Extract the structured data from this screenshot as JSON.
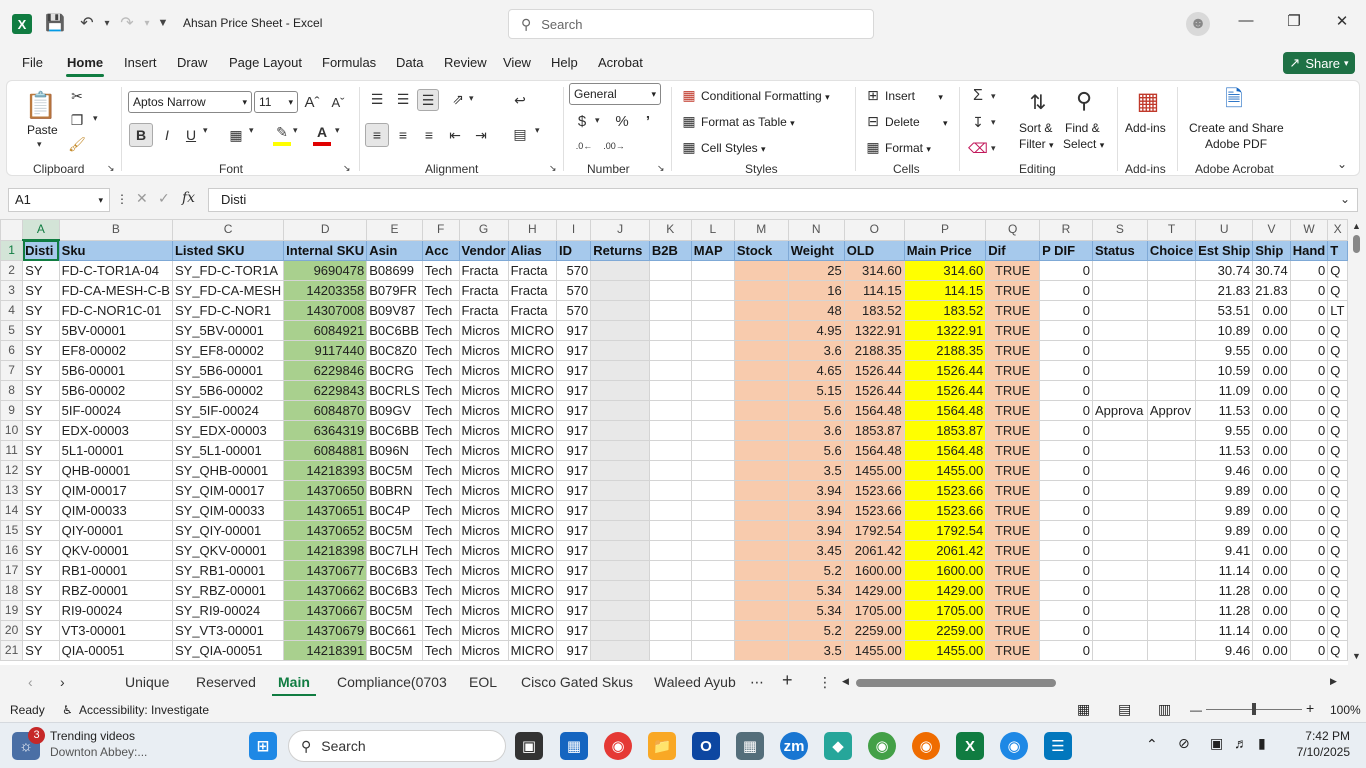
{
  "window": {
    "title": "Ahsan Price Sheet  -  Excel",
    "search_placeholder": "Search"
  },
  "menu": [
    "File",
    "Home",
    "Insert",
    "Draw",
    "Page Layout",
    "Formulas",
    "Data",
    "Review",
    "View",
    "Help",
    "Acrobat"
  ],
  "share_label": "Share",
  "ribbon": {
    "paste": "Paste",
    "clipboard": "Clipboard",
    "font_label": "Font",
    "alignment": "Alignment",
    "number": "Number",
    "styles": "Styles",
    "cells": "Cells",
    "editing": "Editing",
    "addins": "Add-ins",
    "adobe": "Adobe Acrobat",
    "font_name": "Aptos Narrow",
    "font_size": "11",
    "number_format": "General",
    "cond_format": "Conditional Formatting",
    "format_table": "Format as Table",
    "cell_styles": "Cell Styles",
    "insert": "Insert",
    "delete": "Delete",
    "format": "Format",
    "sort": "Sort &",
    "filter": "Filter",
    "find": "Find &",
    "select": "Select",
    "addins_btn": "Add-ins",
    "create_share": "Create and Share",
    "adobe_pdf": "Adobe PDF"
  },
  "formula_bar": {
    "name_box": "A1",
    "fx": "fx",
    "value": "Disti"
  },
  "columns": [
    "A",
    "B",
    "C",
    "D",
    "E",
    "F",
    "G",
    "H",
    "I",
    "J",
    "K",
    "L",
    "M",
    "N",
    "O",
    "P",
    "Q",
    "R",
    "S",
    "T",
    "U",
    "V",
    "W",
    "X"
  ],
  "header_row": [
    "Disti",
    "Sku",
    "Listed SKU",
    "Internal SKU",
    "Asin",
    "Acc",
    "Vendor",
    "Alias",
    "ID",
    "Returns",
    "B2B",
    "MAP",
    "Stock",
    "Weight",
    "OLD",
    "Main Price",
    "Dif",
    "P DIF",
    "Status",
    "Choice",
    "Est Ship",
    "Ship",
    "Hand",
    "T"
  ],
  "rows": [
    [
      "SY",
      "FD-C-TOR1A-04",
      "SY_FD-C-TOR1A",
      "9690478",
      "B08699",
      "Tech",
      "Fracta",
      "Fracta",
      "570",
      "",
      "",
      "",
      "",
      "25",
      "314.60",
      "314.60",
      "TRUE",
      "0",
      "",
      "",
      "30.74",
      "30.74",
      "0",
      "Q"
    ],
    [
      "SY",
      "FD-CA-MESH-C-B",
      "SY_FD-CA-MESH",
      "14203358",
      "B079FR",
      "Tech",
      "Fracta",
      "Fracta",
      "570",
      "",
      "",
      "",
      "",
      "16",
      "114.15",
      "114.15",
      "TRUE",
      "0",
      "",
      "",
      "21.83",
      "21.83",
      "0",
      "Q"
    ],
    [
      "SY",
      "FD-C-NOR1C-01",
      "SY_FD-C-NOR1",
      "14307008",
      "B09V87",
      "Tech",
      "Fracta",
      "Fracta",
      "570",
      "",
      "",
      "",
      "",
      "48",
      "183.52",
      "183.52",
      "TRUE",
      "0",
      "",
      "",
      "53.51",
      "0.00",
      "0",
      "LT"
    ],
    [
      "SY",
      "5BV-00001",
      "SY_5BV-00001",
      "6084921",
      "B0C6BB",
      "Tech",
      "Micros",
      "MICRO",
      "917",
      "",
      "",
      "",
      "",
      "4.95",
      "1322.91",
      "1322.91",
      "TRUE",
      "0",
      "",
      "",
      "10.89",
      "0.00",
      "0",
      "Q"
    ],
    [
      "SY",
      "EF8-00002",
      "SY_EF8-00002",
      "9117440",
      "B0C8Z0",
      "Tech",
      "Micros",
      "MICRO",
      "917",
      "",
      "",
      "",
      "",
      "3.6",
      "2188.35",
      "2188.35",
      "TRUE",
      "0",
      "",
      "",
      "9.55",
      "0.00",
      "0",
      "Q"
    ],
    [
      "SY",
      "5B6-00001",
      "SY_5B6-00001",
      "6229846",
      "B0CRG",
      "Tech",
      "Micros",
      "MICRO",
      "917",
      "",
      "",
      "",
      "",
      "4.65",
      "1526.44",
      "1526.44",
      "TRUE",
      "0",
      "",
      "",
      "10.59",
      "0.00",
      "0",
      "Q"
    ],
    [
      "SY",
      "5B6-00002",
      "SY_5B6-00002",
      "6229843",
      "B0CRLS",
      "Tech",
      "Micros",
      "MICRO",
      "917",
      "",
      "",
      "",
      "",
      "5.15",
      "1526.44",
      "1526.44",
      "TRUE",
      "0",
      "",
      "",
      "11.09",
      "0.00",
      "0",
      "Q"
    ],
    [
      "SY",
      "5IF-00024",
      "SY_5IF-00024",
      "6084870",
      "B09GV",
      "Tech",
      "Micros",
      "MICRO",
      "917",
      "",
      "",
      "",
      "",
      "5.6",
      "1564.48",
      "1564.48",
      "TRUE",
      "0",
      "Approva",
      "Approv",
      "11.53",
      "0.00",
      "0",
      "Q"
    ],
    [
      "SY",
      "EDX-00003",
      "SY_EDX-00003",
      "6364319",
      "B0C6BB",
      "Tech",
      "Micros",
      "MICRO",
      "917",
      "",
      "",
      "",
      "",
      "3.6",
      "1853.87",
      "1853.87",
      "TRUE",
      "0",
      "",
      "",
      "9.55",
      "0.00",
      "0",
      "Q"
    ],
    [
      "SY",
      "5L1-00001",
      "SY_5L1-00001",
      "6084881",
      "B096N",
      "Tech",
      "Micros",
      "MICRO",
      "917",
      "",
      "",
      "",
      "",
      "5.6",
      "1564.48",
      "1564.48",
      "TRUE",
      "0",
      "",
      "",
      "11.53",
      "0.00",
      "0",
      "Q"
    ],
    [
      "SY",
      "QHB-00001",
      "SY_QHB-00001",
      "14218393",
      "B0C5M",
      "Tech",
      "Micros",
      "MICRO",
      "917",
      "",
      "",
      "",
      "",
      "3.5",
      "1455.00",
      "1455.00",
      "TRUE",
      "0",
      "",
      "",
      "9.46",
      "0.00",
      "0",
      "Q"
    ],
    [
      "SY",
      "QIM-00017",
      "SY_QIM-00017",
      "14370650",
      "B0BRN",
      "Tech",
      "Micros",
      "MICRO",
      "917",
      "",
      "",
      "",
      "",
      "3.94",
      "1523.66",
      "1523.66",
      "TRUE",
      "0",
      "",
      "",
      "9.89",
      "0.00",
      "0",
      "Q"
    ],
    [
      "SY",
      "QIM-00033",
      "SY_QIM-00033",
      "14370651",
      "B0C4P",
      "Tech",
      "Micros",
      "MICRO",
      "917",
      "",
      "",
      "",
      "",
      "3.94",
      "1523.66",
      "1523.66",
      "TRUE",
      "0",
      "",
      "",
      "9.89",
      "0.00",
      "0",
      "Q"
    ],
    [
      "SY",
      "QIY-00001",
      "SY_QIY-00001",
      "14370652",
      "B0C5M",
      "Tech",
      "Micros",
      "MICRO",
      "917",
      "",
      "",
      "",
      "",
      "3.94",
      "1792.54",
      "1792.54",
      "TRUE",
      "0",
      "",
      "",
      "9.89",
      "0.00",
      "0",
      "Q"
    ],
    [
      "SY",
      "QKV-00001",
      "SY_QKV-00001",
      "14218398",
      "B0C7LH",
      "Tech",
      "Micros",
      "MICRO",
      "917",
      "",
      "",
      "",
      "",
      "3.45",
      "2061.42",
      "2061.42",
      "TRUE",
      "0",
      "",
      "",
      "9.41",
      "0.00",
      "0",
      "Q"
    ],
    [
      "SY",
      "RB1-00001",
      "SY_RB1-00001",
      "14370677",
      "B0C6B3",
      "Tech",
      "Micros",
      "MICRO",
      "917",
      "",
      "",
      "",
      "",
      "5.2",
      "1600.00",
      "1600.00",
      "TRUE",
      "0",
      "",
      "",
      "11.14",
      "0.00",
      "0",
      "Q"
    ],
    [
      "SY",
      "RBZ-00001",
      "SY_RBZ-00001",
      "14370662",
      "B0C6B3",
      "Tech",
      "Micros",
      "MICRO",
      "917",
      "",
      "",
      "",
      "",
      "5.34",
      "1429.00",
      "1429.00",
      "TRUE",
      "0",
      "",
      "",
      "11.28",
      "0.00",
      "0",
      "Q"
    ],
    [
      "SY",
      "RI9-00024",
      "SY_RI9-00024",
      "14370667",
      "B0C5M",
      "Tech",
      "Micros",
      "MICRO",
      "917",
      "",
      "",
      "",
      "",
      "5.34",
      "1705.00",
      "1705.00",
      "TRUE",
      "0",
      "",
      "",
      "11.28",
      "0.00",
      "0",
      "Q"
    ],
    [
      "SY",
      "VT3-00001",
      "SY_VT3-00001",
      "14370679",
      "B0C661",
      "Tech",
      "Micros",
      "MICRO",
      "917",
      "",
      "",
      "",
      "",
      "5.2",
      "2259.00",
      "2259.00",
      "TRUE",
      "0",
      "",
      "",
      "11.14",
      "0.00",
      "0",
      "Q"
    ],
    [
      "SY",
      "QIA-00051",
      "SY_QIA-00051",
      "14218391",
      "B0C5M",
      "Tech",
      "Micros",
      "MICRO",
      "917",
      "",
      "",
      "",
      "",
      "3.5",
      "1455.00",
      "1455.00",
      "TRUE",
      "0",
      "",
      "",
      "9.46",
      "0.00",
      "0",
      "Q"
    ]
  ],
  "sheets": [
    "Unique",
    "Reserved",
    "Main",
    "Compliance(0703",
    "EOL",
    "Cisco Gated Skus",
    "Waleed Ayub"
  ],
  "status": {
    "ready": "Ready",
    "accessibility": "Accessibility: Investigate",
    "zoom": "100%"
  },
  "taskbar": {
    "news_title": "Trending videos",
    "news_sub": "Downton Abbey:...",
    "news_badge": "3",
    "search": "Search",
    "time": "7:42 PM",
    "date": "7/10/2025"
  }
}
